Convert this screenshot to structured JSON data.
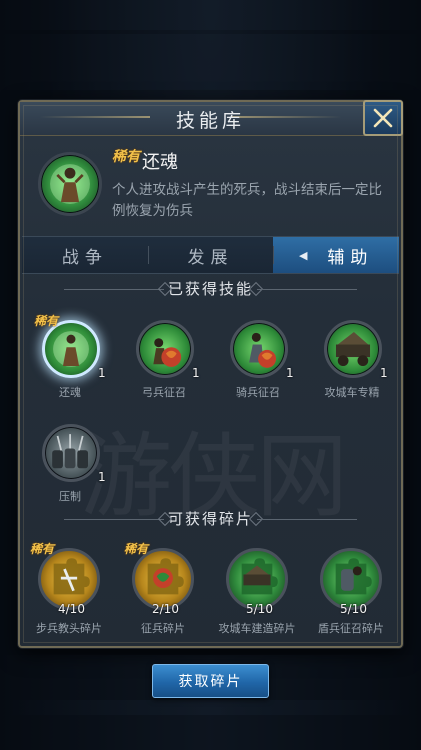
{
  "dialog": {
    "title": "技能库",
    "close_icon": "close-icon"
  },
  "featured": {
    "badge": "稀有",
    "name": "还魂",
    "description": "个人进攻战斗产生的死兵，战斗结束后一定比例恢复为伤兵"
  },
  "tabs": [
    {
      "label": "战争",
      "active": false
    },
    {
      "label": "发展",
      "active": false
    },
    {
      "label": "辅助",
      "active": true
    }
  ],
  "acquired": {
    "heading": "已获得技能",
    "skills": [
      {
        "name": "还魂",
        "level": "1",
        "badge": "稀有",
        "selected": true
      },
      {
        "name": "弓兵征召",
        "level": "1"
      },
      {
        "name": "骑兵征召",
        "level": "1"
      },
      {
        "name": "攻城车专精",
        "level": "1"
      },
      {
        "name": "压制",
        "level": "1"
      }
    ]
  },
  "fragments": {
    "heading": "可获得碎片",
    "items": [
      {
        "name": "步兵教头碎片",
        "count": "4/10",
        "badge": "稀有"
      },
      {
        "name": "征兵碎片",
        "count": "2/10",
        "badge": "稀有"
      },
      {
        "name": "攻城车建造碎片",
        "count": "5/10"
      },
      {
        "name": "盾兵征召碎片",
        "count": "5/10"
      }
    ]
  },
  "footer": {
    "button_label": "获取碎片"
  },
  "colors": {
    "accent_blue": "#2f6ea5",
    "rare_gold": "#f2c14a",
    "skill_green": "#2f8a3c"
  }
}
